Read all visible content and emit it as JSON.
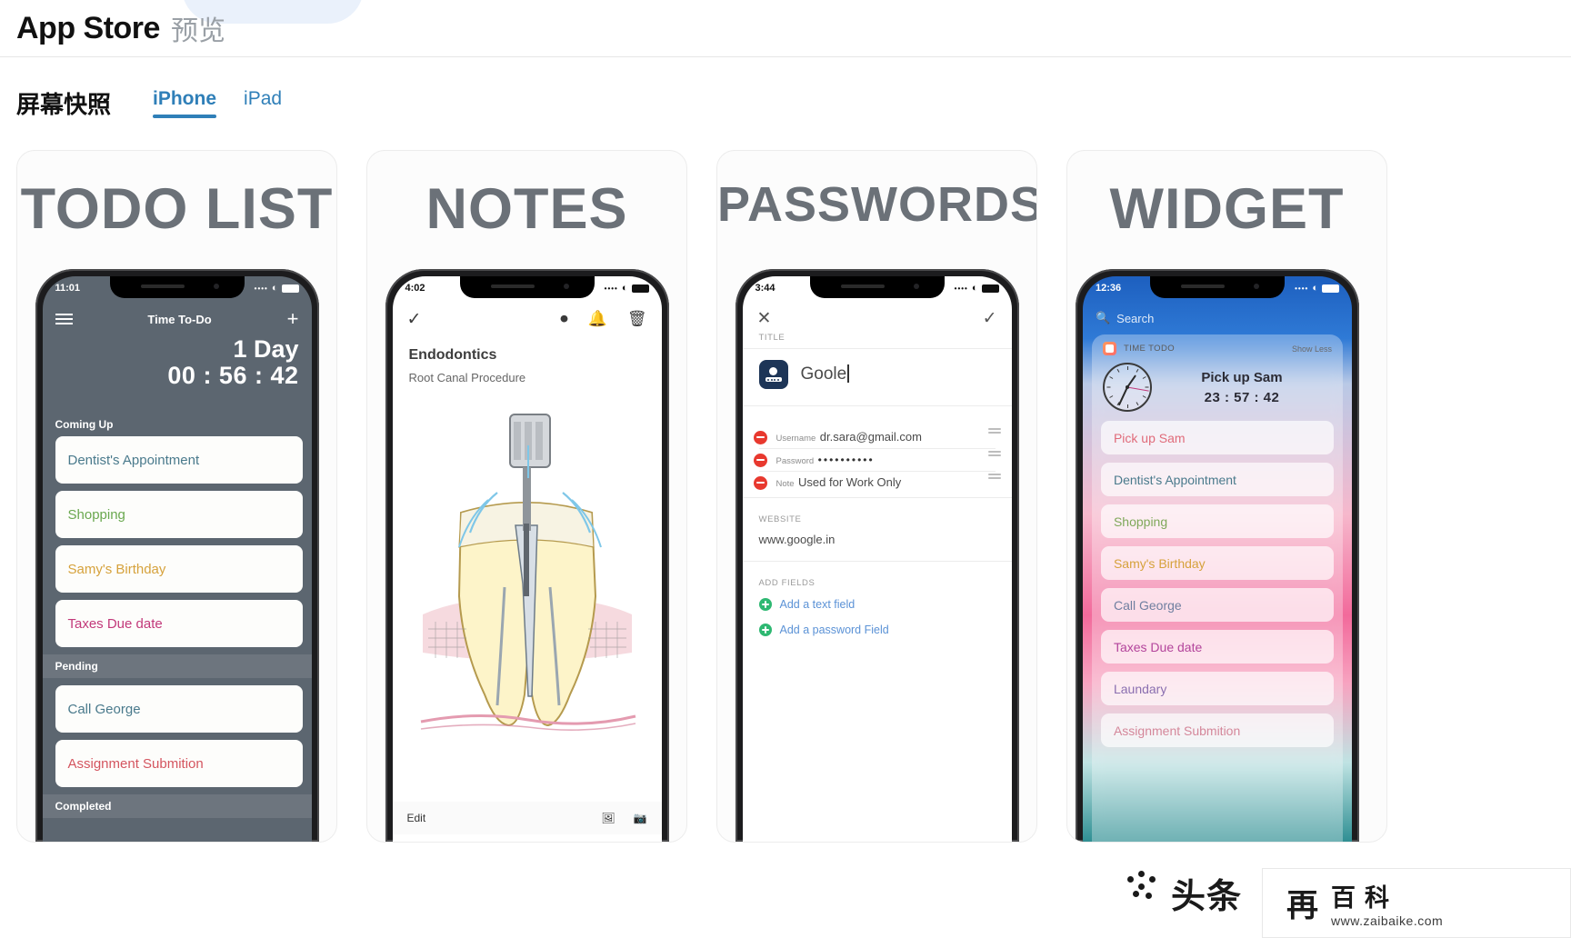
{
  "header": {
    "title": "App Store",
    "subtitle": "预览"
  },
  "section": {
    "title": "屏幕快照",
    "tabs": [
      {
        "label": "iPhone",
        "active": true
      },
      {
        "label": "iPad",
        "active": false
      }
    ]
  },
  "cards": [
    {
      "title": "TODO LIST",
      "phone": {
        "status": {
          "time": "11:01",
          "signal": "••••",
          "wifi": "wifi-icon",
          "battery": "battery-icon"
        },
        "nav": {
          "menu": "hamburger-icon",
          "title": "Time To-Do",
          "add": "+"
        },
        "countdown": {
          "day": "1 Day",
          "time": "00 : 56 : 42"
        },
        "sections": [
          {
            "heading": "Coming Up",
            "items": [
              {
                "label": "Dentist's Appointment",
                "color": "#4a7a8c"
              },
              {
                "label": "Shopping",
                "color": "#6aa84f"
              },
              {
                "label": "Samy's Birthday",
                "color": "#d6a23c"
              },
              {
                "label": "Taxes Due date",
                "color": "#c2397a"
              }
            ]
          },
          {
            "heading": "Pending",
            "items": [
              {
                "label": "Call George",
                "color": "#4a7a8c"
              },
              {
                "label": "Assignment Submition",
                "color": "#d4555f"
              }
            ]
          },
          {
            "heading": "Completed",
            "items": []
          }
        ]
      }
    },
    {
      "title": "NOTES",
      "phone": {
        "status": {
          "time": "4:02",
          "signal": "••••",
          "wifi": "wifi-icon",
          "battery": "battery-icon"
        },
        "nav": {
          "done": "check-icon",
          "record": "voice-record-icon",
          "reminder": "bell-icon",
          "delete": "trash-icon"
        },
        "note": {
          "title": "Endodontics",
          "subtitle": "Root Canal Procedure",
          "drawing": "tooth-root-canal-illustration"
        },
        "toolbar": {
          "edit": "Edit",
          "gallery": "image-icon",
          "camera": "camera-icon"
        }
      }
    },
    {
      "title": "PASSWORDS",
      "phone": {
        "status": {
          "time": "3:44",
          "signal": "••••",
          "wifi": "wifi-icon",
          "battery": "battery-icon"
        },
        "nav": {
          "close": "close-icon",
          "save": "check-icon"
        },
        "title_section": {
          "label": "TITLE",
          "value": "Goole",
          "app_icon": "password-app-icon"
        },
        "fields": [
          {
            "label": "Username",
            "value": "dr.sara@gmail.com"
          },
          {
            "label": "Password",
            "value": "••••••••••"
          },
          {
            "label": "Note",
            "value": "Used for Work Only"
          }
        ],
        "website": {
          "label": "WEBSITE",
          "value": "www.google.in"
        },
        "add_fields": {
          "label": "ADD FIELDS",
          "options": [
            {
              "label": "Add a text field"
            },
            {
              "label": "Add a password Field"
            }
          ]
        }
      }
    },
    {
      "title": "WIDGET",
      "phone": {
        "status": {
          "time": "12:36",
          "signal": "••••",
          "wifi": "wifi-icon",
          "battery": "battery-icon"
        },
        "search": {
          "placeholder": "Search",
          "icon": "search-icon"
        },
        "widget": {
          "app_name": "TIME TODO",
          "show_less": "Show Less",
          "task": "Pick up Sam",
          "timer": "23 : 57 : 42",
          "items": [
            {
              "label": "Pick up Sam",
              "color": "#e06b7a"
            },
            {
              "label": "Dentist's Appointment",
              "color": "#4a7a8c"
            },
            {
              "label": "Shopping",
              "color": "#7fa85a"
            },
            {
              "label": "Samy's Birthday",
              "color": "#d6a23c"
            },
            {
              "label": "Call George",
              "color": "#6f7fa0"
            },
            {
              "label": "Taxes Due date",
              "color": "#b3449b"
            },
            {
              "label": "Laundary",
              "color": "#8a6fb0"
            },
            {
              "label": "Assignment Submition",
              "color": "#d4879a"
            }
          ]
        }
      }
    }
  ],
  "watermark": {
    "text": "头条",
    "logo": "再",
    "brand": "百科",
    "url": "www.zaibaike.com"
  }
}
